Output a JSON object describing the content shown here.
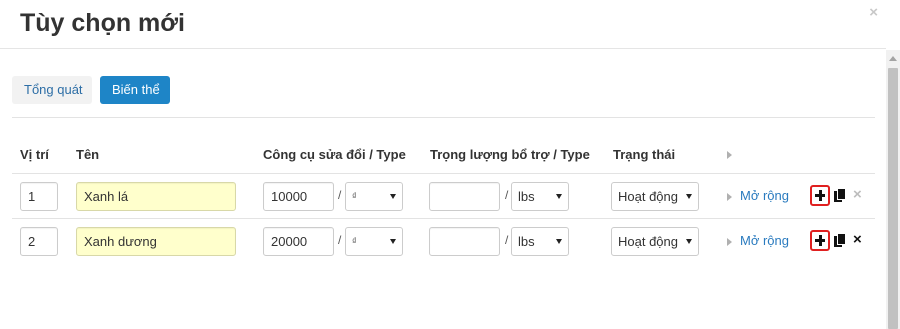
{
  "modal": {
    "title": "Tùy chọn mới",
    "close_glyph": "×"
  },
  "tabs": [
    {
      "label": "Tổng quát",
      "active": false
    },
    {
      "label": "Biến thể",
      "active": true
    }
  ],
  "table": {
    "headers": {
      "position": "Vị trí",
      "name": "Tên",
      "modifier": "Công cụ sửa đổi / Type",
      "weight": "Trọng lượng bổ trợ / Type",
      "status": "Trạng thái"
    },
    "rows": [
      {
        "position": "1",
        "name": "Xanh lá",
        "modifier_value": "10000",
        "modifier_type": "₫",
        "weight_value": "",
        "weight_type": "lbs",
        "status": "Hoạt động",
        "expand_label": "Mở rộng",
        "delete_enabled": false
      },
      {
        "position": "2",
        "name": "Xanh dương",
        "modifier_value": "20000",
        "modifier_type": "₫",
        "weight_value": "",
        "weight_type": "lbs",
        "status": "Hoạt động",
        "expand_label": "Mở rộng",
        "delete_enabled": true
      }
    ]
  },
  "icons": {
    "add": "plus-icon",
    "clone": "copy-icon",
    "delete": "close-icon",
    "expand": "caret-right-icon"
  },
  "colors": {
    "accent": "#1e85c7",
    "link": "#2a7bbf",
    "highlight_border": "#e02020",
    "name_field_bg": "#ffffcc"
  },
  "separator": "/"
}
